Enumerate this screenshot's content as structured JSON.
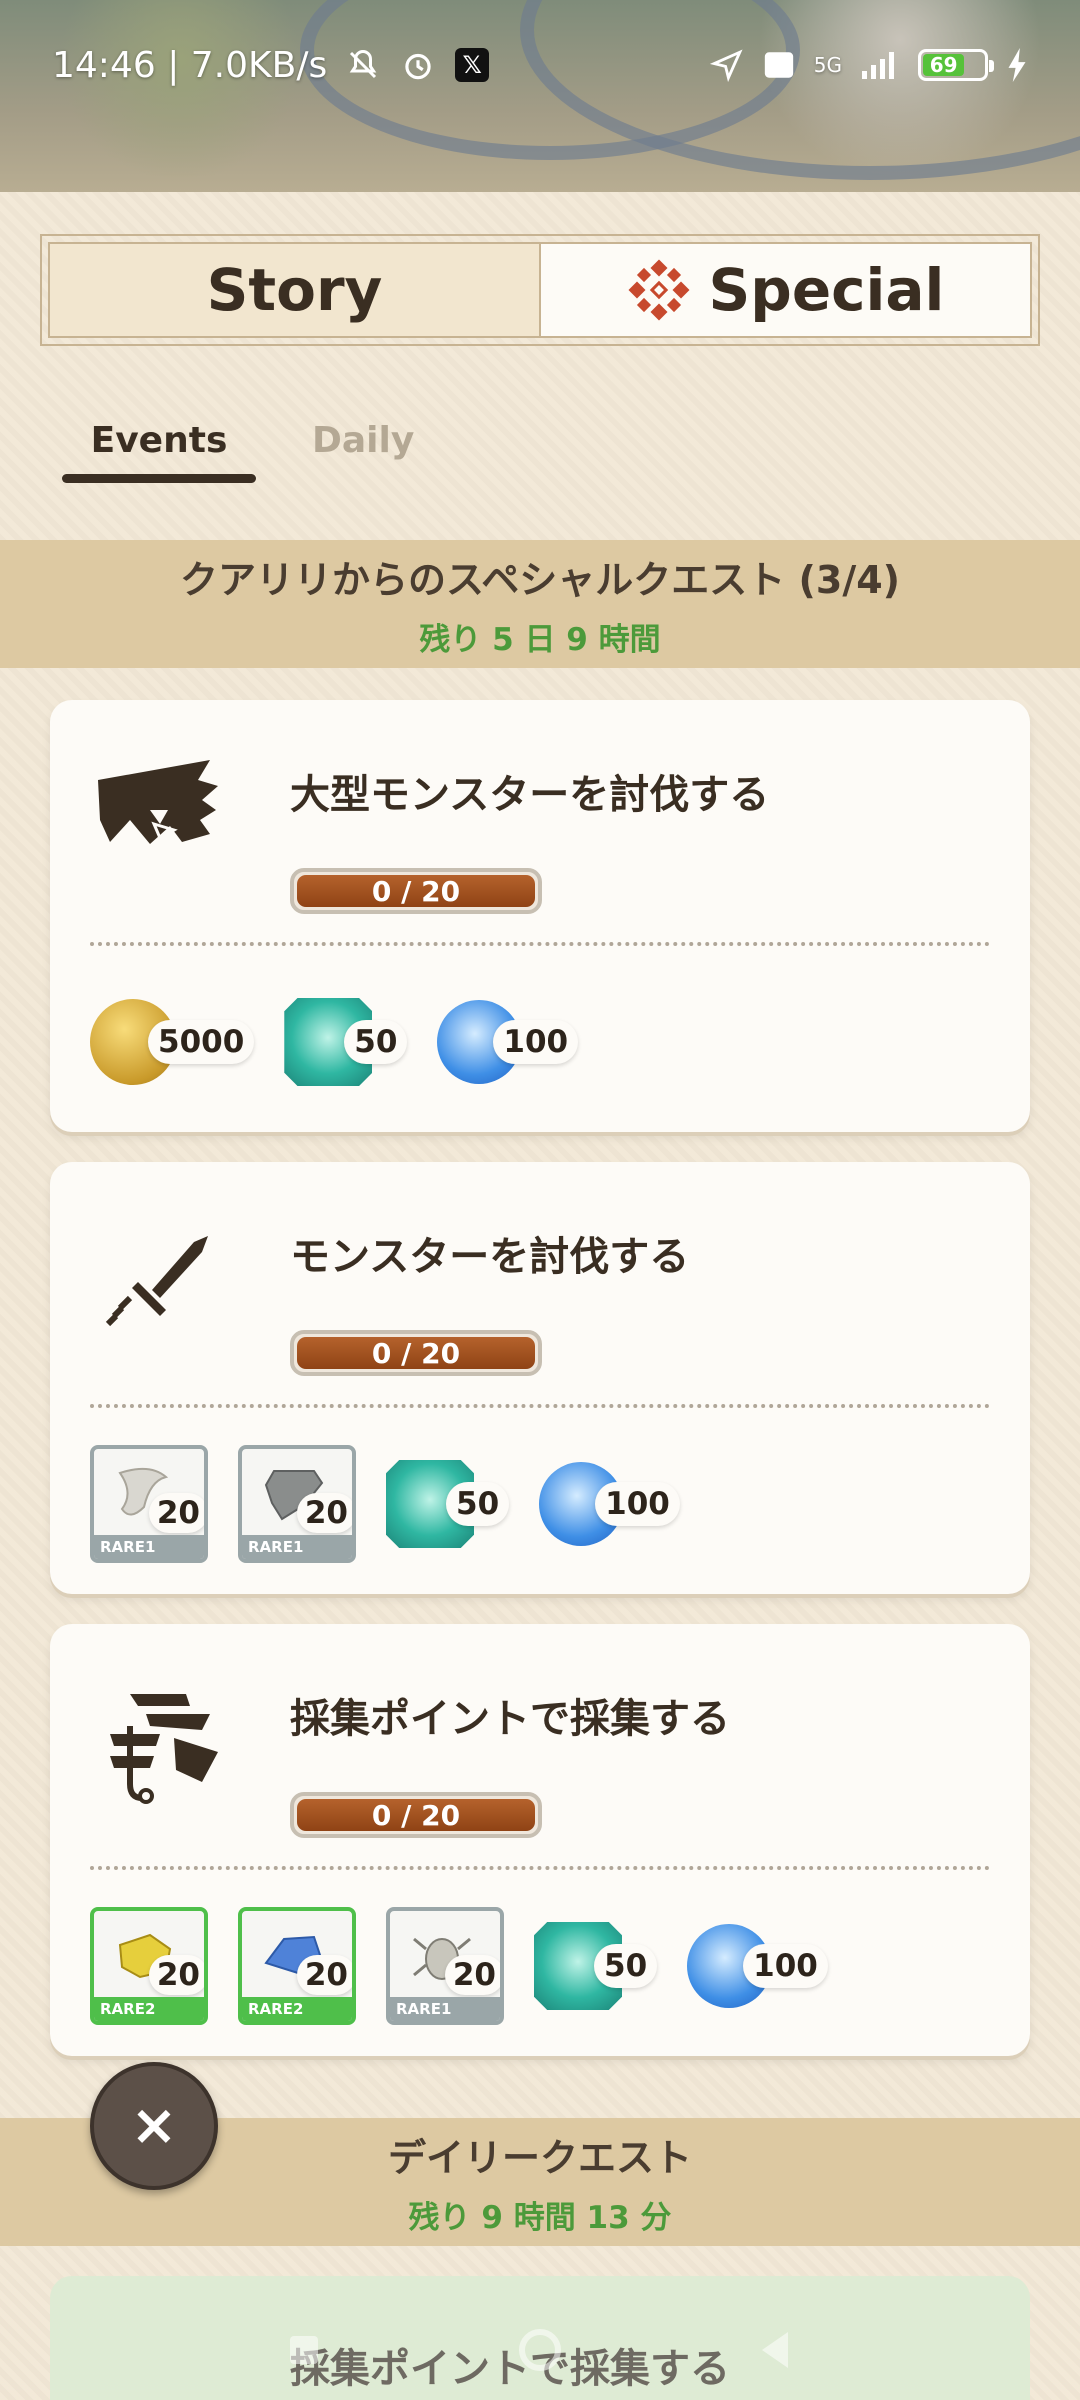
{
  "status_bar": {
    "time_speed": "14:46 | 7.0KB/s",
    "network": "5G",
    "battery": "69"
  },
  "tabs": {
    "story_label": "Story",
    "special_label": "Special"
  },
  "subtabs": {
    "events_label": "Events",
    "daily_label": "Daily"
  },
  "special_section": {
    "title": "クアリリからのスペシャルクエスト (3/4)",
    "remaining": "残り 5 日 9 時間"
  },
  "quests": [
    {
      "title": "大型モンスターを討伐する",
      "icon": "large-monster-icon",
      "progress_text": "0 / 20",
      "progress": 0,
      "rewards": [
        {
          "type": "coin",
          "qty": "5000"
        },
        {
          "type": "gem",
          "qty": "50"
        },
        {
          "type": "orb",
          "qty": "100"
        }
      ]
    },
    {
      "title": "モンスターを討伐する",
      "icon": "sword-icon",
      "progress_text": "0 / 20",
      "progress": 0,
      "rewards": [
        {
          "type": "material",
          "rarity": "RARE1",
          "qty": "20"
        },
        {
          "type": "material",
          "rarity": "RARE1",
          "qty": "20"
        },
        {
          "type": "gem",
          "qty": "50"
        },
        {
          "type": "orb",
          "qty": "100"
        }
      ]
    },
    {
      "title": "採集ポイントで採集する",
      "icon": "gathering-icon",
      "progress_text": "0 / 20",
      "progress": 0,
      "rewards": [
        {
          "type": "material",
          "rarity": "RARE2",
          "qty": "20"
        },
        {
          "type": "material",
          "rarity": "RARE2",
          "qty": "20"
        },
        {
          "type": "material",
          "rarity": "RARE1",
          "qty": "20"
        },
        {
          "type": "gem",
          "qty": "50"
        },
        {
          "type": "orb",
          "qty": "100"
        }
      ]
    }
  ],
  "daily_section": {
    "title": "デイリークエスト",
    "remaining": "残り 9 時間 13 分"
  },
  "ghost_quest_title": "採集ポイントで採集する",
  "close_button": "×",
  "colors": {
    "band": "#ddc9a2",
    "remaining_green": "#4c9a3a",
    "progress_brown": "#a4531f",
    "rare1": "#9aa6a8",
    "rare2": "#4fbf4a"
  }
}
